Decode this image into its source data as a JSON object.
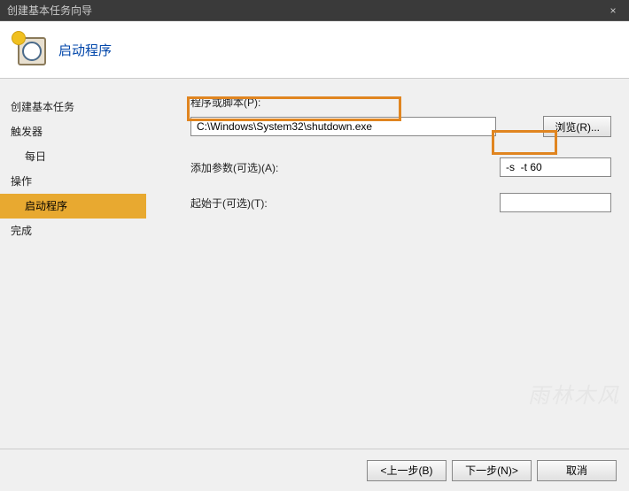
{
  "window": {
    "title": "创建基本任务向导",
    "close": "×"
  },
  "header": {
    "title": "启动程序"
  },
  "sidebar": {
    "items": [
      {
        "label": "创建基本任务",
        "sub": false,
        "active": false
      },
      {
        "label": "触发器",
        "sub": false,
        "active": false
      },
      {
        "label": "每日",
        "sub": true,
        "active": false
      },
      {
        "label": "操作",
        "sub": false,
        "active": false
      },
      {
        "label": "启动程序",
        "sub": true,
        "active": true
      },
      {
        "label": "完成",
        "sub": false,
        "active": false
      }
    ]
  },
  "form": {
    "program_label": "程序或脚本(P):",
    "program_value": "C:\\Windows\\System32\\shutdown.exe",
    "browse_label": "浏览(R)...",
    "args_label": "添加参数(可选)(A):",
    "args_value": "-s  -t 60",
    "startin_label": "起始于(可选)(T):",
    "startin_value": ""
  },
  "footer": {
    "back": "<上一步(B)",
    "next": "下一步(N)>",
    "cancel": "取消"
  }
}
